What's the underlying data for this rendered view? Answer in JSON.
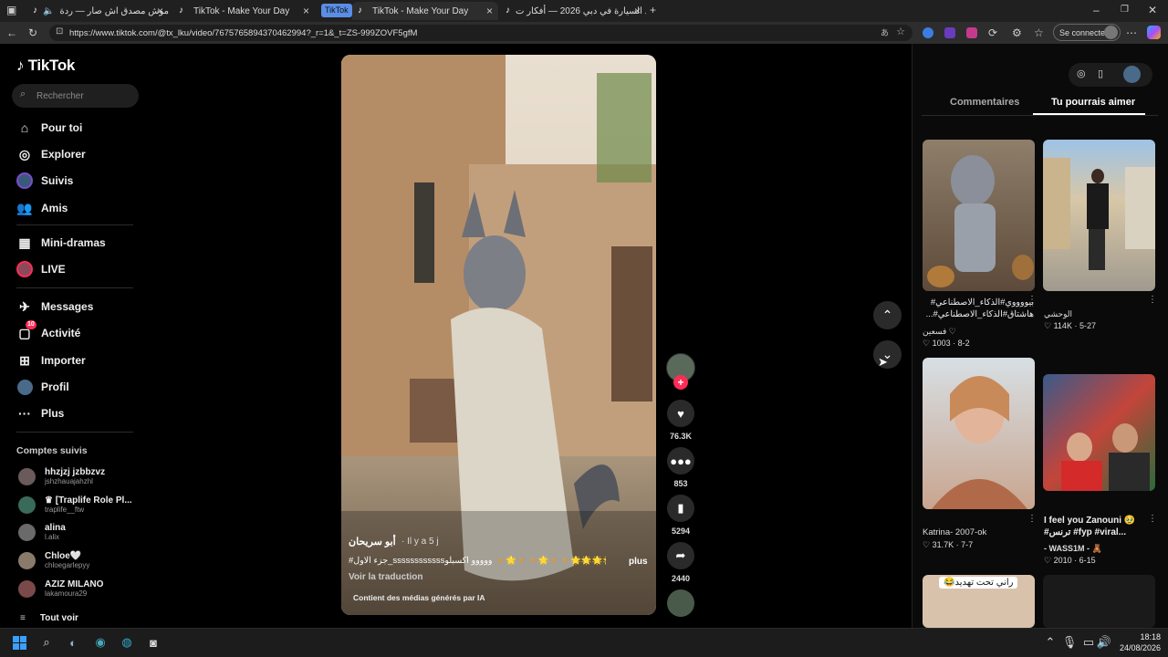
{
  "browser": {
    "tabs": [
      {
        "title": "موش مصدق اش صار — ردة",
        "active": false
      },
      {
        "title": "TikTok - Make Your Day",
        "active": false
      },
      {
        "title": "TikTok",
        "group": true
      },
      {
        "title": "TikTok - Make Your Day",
        "active": true
      },
      {
        "title": "ترند السيارة في دبي 2026 — أفكار ت",
        "active": false
      }
    ],
    "url": "https://www.tiktok.com/@tx_lku/video/7675765894370462994?_r=1&_t=ZS-999ZOVF5gfM",
    "signin_label": "Se connecter"
  },
  "sidebar": {
    "logo": "TikTok",
    "search_placeholder": "Rechercher",
    "nav": [
      {
        "label": "Pour toi",
        "icon": "home-icon"
      },
      {
        "label": "Explorer",
        "icon": "compass-icon"
      },
      {
        "label": "Suivis",
        "icon": "following-icon"
      },
      {
        "label": "Amis",
        "icon": "friends-icon"
      },
      {
        "label": "Mini-dramas",
        "icon": "film-icon"
      },
      {
        "label": "LIVE",
        "icon": "live-icon"
      },
      {
        "label": "Messages",
        "icon": "message-icon"
      },
      {
        "label": "Activité",
        "icon": "activity-icon",
        "badge": "10"
      },
      {
        "label": "Importer",
        "icon": "upload-icon"
      },
      {
        "label": "Profil",
        "icon": "profile-icon"
      },
      {
        "label": "Plus",
        "icon": "more-icon"
      }
    ],
    "followed_title": "Comptes suivis",
    "accounts": [
      {
        "name": "hhzjzj jzbbzvz",
        "handle": "jshzhauajahzhl"
      },
      {
        "name": "♛ [Traplife Role Pl...",
        "handle": "traplife__ftw"
      },
      {
        "name": "alina",
        "handle": "l.alix"
      },
      {
        "name": "Chloe🤍",
        "handle": "chloegarlepyy"
      },
      {
        "name": "AZIZ MILANO",
        "handle": "lakamoura29"
      }
    ],
    "see_all": "Tout voir"
  },
  "video": {
    "author": "أبو سريحان",
    "time": "· Il y a 5 j",
    "caption": "#جزء الاول_ssssssssssssووووو اكسبلو 🔸🌟🔸🔸🌟🔸🔸🌟🌟🌟🌟🌟 ...",
    "more": "plus",
    "translate": "Voir la traduction",
    "ai_label": "Contient des médias générés par IA"
  },
  "actions": {
    "likes": "76.3K",
    "comments": "853",
    "saves": "5294",
    "shares": "2440"
  },
  "right_panel": {
    "tabs": [
      "Commentaires",
      "Tu pourrais aimer"
    ],
    "active_tab": "Tu pourrais aimer",
    "items": [
      {
        "caption": "بيووووي#الذكاء_الاصطناعي# هاشتاق#الذكاء_الاصطناعي#...",
        "author": "فسعين ♡",
        "likes": "1003",
        "date": "8-2"
      },
      {
        "caption": "",
        "author": "الوحشي",
        "likes": "114K",
        "date": "5-27"
      },
      {
        "caption": "",
        "author": "Katrina- 2007-ok",
        "likes": "31.7K",
        "date": "7-7"
      },
      {
        "caption": "I feel you Zanouni 🥹 #ترنس #fyp #viral...",
        "author": "- WASS1M - 🧸",
        "likes": "2010",
        "date": "6-15"
      },
      {
        "caption": "راني تحت تهديد😂",
        "author": "",
        "likes": "",
        "date": ""
      }
    ]
  },
  "taskbar": {
    "time": "18:18",
    "date": "24/08/2026"
  },
  "colors": {
    "accent": "#fe2c55",
    "tab_underline": "#ffffff"
  }
}
